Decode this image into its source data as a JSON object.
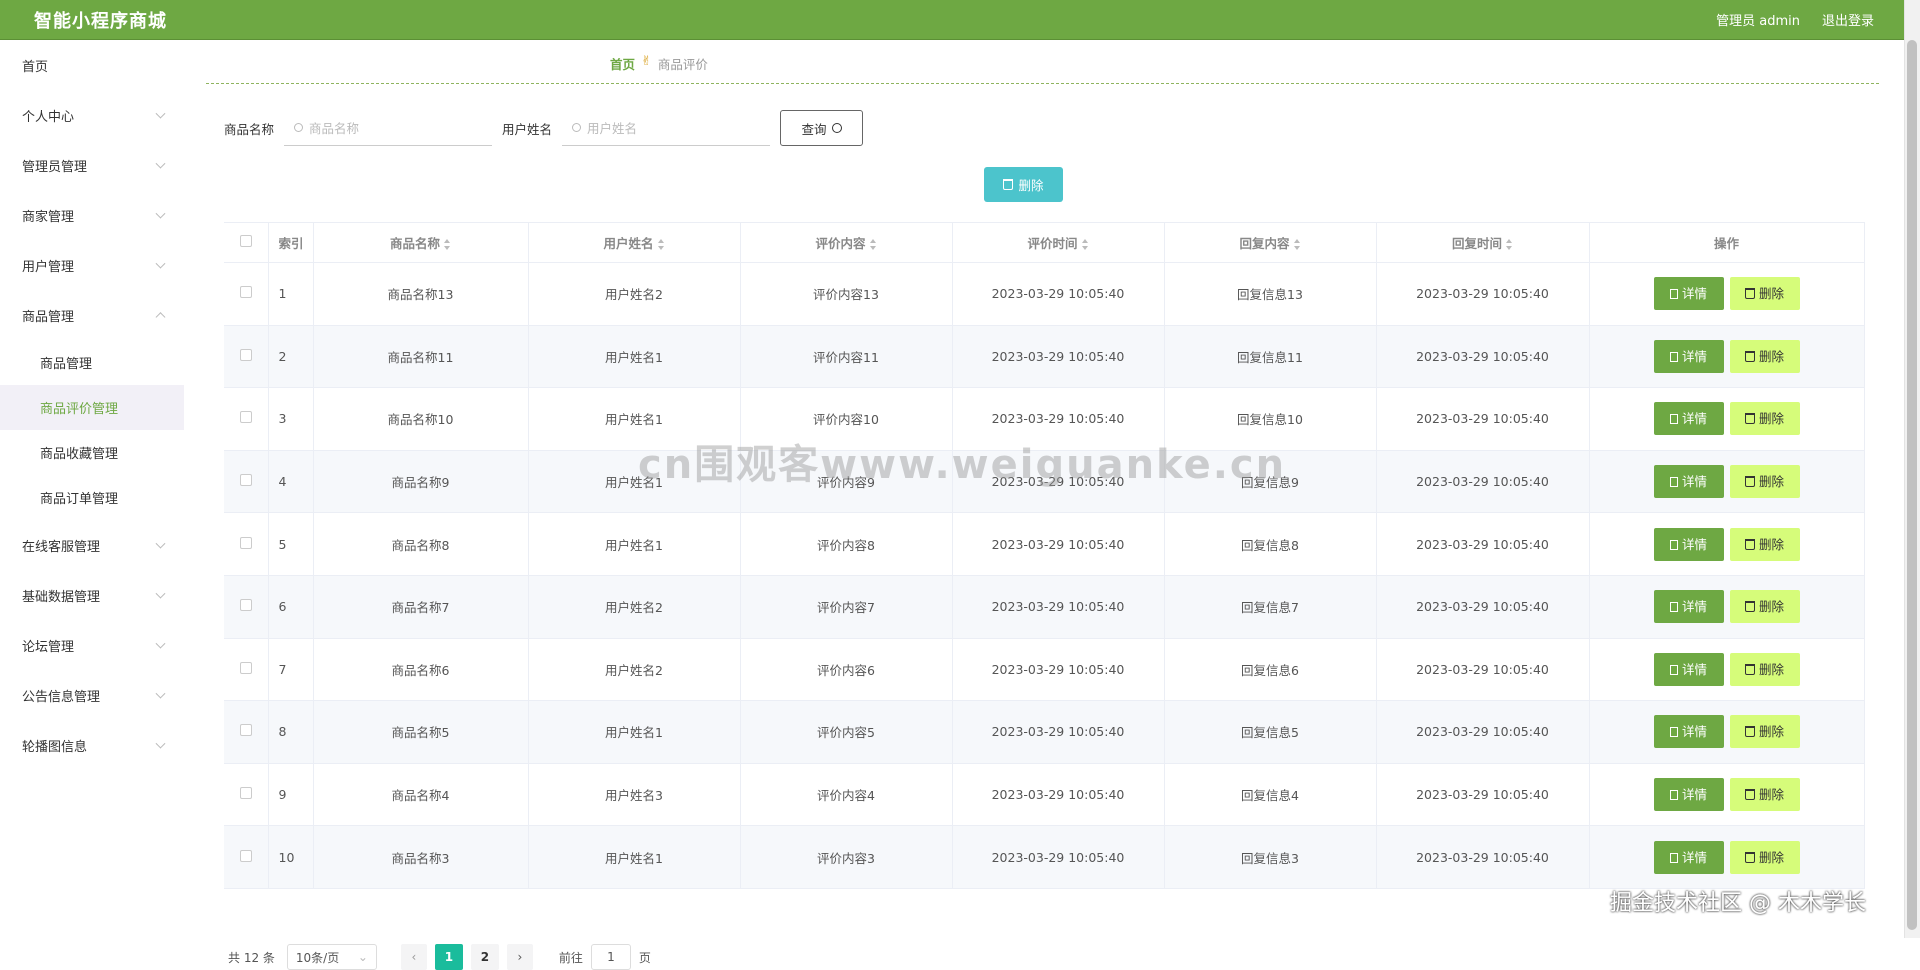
{
  "app": {
    "title": "智能小程序商城",
    "user_label": "管理员 admin",
    "logout": "退出登录"
  },
  "sidebar": {
    "items": [
      {
        "label": "首页",
        "chevron": false
      },
      {
        "label": "个人中心",
        "chevron": true
      },
      {
        "label": "管理员管理",
        "chevron": true
      },
      {
        "label": "商家管理",
        "chevron": true
      },
      {
        "label": "用户管理",
        "chevron": true
      },
      {
        "label": "商品管理",
        "chevron": true,
        "open": true
      }
    ],
    "sub_items": [
      "商品管理",
      "商品评价管理",
      "商品收藏管理",
      "商品订单管理"
    ],
    "active_sub": "商品评价管理",
    "items_after": [
      "在线客服管理",
      "基础数据管理",
      "论坛管理",
      "公告信息管理",
      "轮播图信息"
    ]
  },
  "breadcrumb": {
    "home": "首页",
    "current": "商品评价"
  },
  "search": {
    "product_label": "商品名称",
    "product_placeholder": "商品名称",
    "user_label": "用户姓名",
    "user_placeholder": "用户姓名",
    "query_button": "查询"
  },
  "batch_delete": "删除",
  "table": {
    "headers": [
      "索引",
      "商品名称",
      "用户姓名",
      "评价内容",
      "评价时间",
      "回复内容",
      "回复时间",
      "操作"
    ],
    "rows": [
      {
        "idx": "1",
        "product": "商品名称13",
        "user": "用户姓名2",
        "content": "评价内容13",
        "time": "2023-03-29 10:05:40",
        "reply": "回复信息13",
        "reply_time": "2023-03-29 10:05:40"
      },
      {
        "idx": "2",
        "product": "商品名称11",
        "user": "用户姓名1",
        "content": "评价内容11",
        "time": "2023-03-29 10:05:40",
        "reply": "回复信息11",
        "reply_time": "2023-03-29 10:05:40"
      },
      {
        "idx": "3",
        "product": "商品名称10",
        "user": "用户姓名1",
        "content": "评价内容10",
        "time": "2023-03-29 10:05:40",
        "reply": "回复信息10",
        "reply_time": "2023-03-29 10:05:40"
      },
      {
        "idx": "4",
        "product": "商品名称9",
        "user": "用户姓名1",
        "content": "评价内容9",
        "time": "2023-03-29 10:05:40",
        "reply": "回复信息9",
        "reply_time": "2023-03-29 10:05:40"
      },
      {
        "idx": "5",
        "product": "商品名称8",
        "user": "用户姓名1",
        "content": "评价内容8",
        "time": "2023-03-29 10:05:40",
        "reply": "回复信息8",
        "reply_time": "2023-03-29 10:05:40"
      },
      {
        "idx": "6",
        "product": "商品名称7",
        "user": "用户姓名2",
        "content": "评价内容7",
        "time": "2023-03-29 10:05:40",
        "reply": "回复信息7",
        "reply_time": "2023-03-29 10:05:40"
      },
      {
        "idx": "7",
        "product": "商品名称6",
        "user": "用户姓名2",
        "content": "评价内容6",
        "time": "2023-03-29 10:05:40",
        "reply": "回复信息6",
        "reply_time": "2023-03-29 10:05:40"
      },
      {
        "idx": "8",
        "product": "商品名称5",
        "user": "用户姓名1",
        "content": "评价内容5",
        "time": "2023-03-29 10:05:40",
        "reply": "回复信息5",
        "reply_time": "2023-03-29 10:05:40"
      },
      {
        "idx": "9",
        "product": "商品名称4",
        "user": "用户姓名3",
        "content": "评价内容4",
        "time": "2023-03-29 10:05:40",
        "reply": "回复信息4",
        "reply_time": "2023-03-29 10:05:40"
      },
      {
        "idx": "10",
        "product": "商品名称3",
        "user": "用户姓名1",
        "content": "评价内容3",
        "time": "2023-03-29 10:05:40",
        "reply": "回复信息3",
        "reply_time": "2023-03-29 10:05:40"
      }
    ],
    "detail_label": "详情",
    "delete_label": "删除"
  },
  "pagination": {
    "total": "共 12 条",
    "page_size": "10条/页",
    "pages": [
      "1",
      "2"
    ],
    "current_page": "1",
    "goto_label": "前往",
    "goto_value": "1",
    "page_unit": "页"
  },
  "watermark": "cn围观客www.weiguanke.cn",
  "credit": "掘金技术社区 @ 木木学长",
  "colors": {
    "header": "#6ea843",
    "detail_button": "#6ea843",
    "delete_button": "#d6fc7a",
    "batch_delete": "#4cc4cc",
    "active_page": "#1abc9c"
  }
}
